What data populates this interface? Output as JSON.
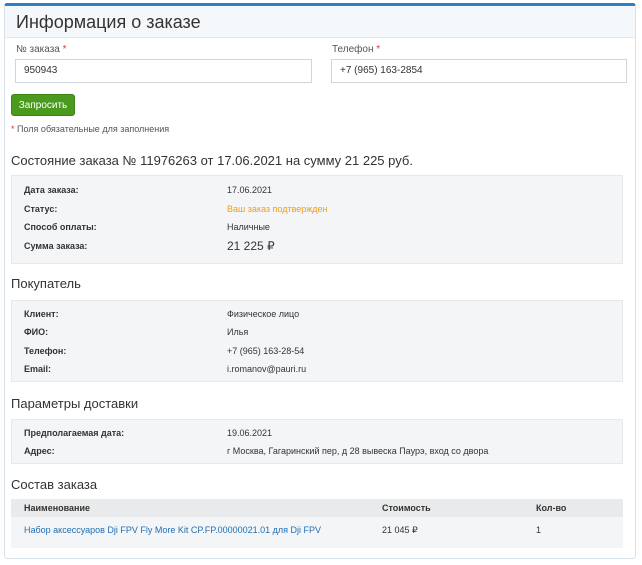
{
  "page": {
    "title": "Информация о заказе"
  },
  "form": {
    "order_label": "№ заказа",
    "order_value": "950943",
    "phone_label": "Телефон",
    "phone_value": "+7 (965) 163-2854",
    "required_mark": "*",
    "submit_label": "Запросить",
    "required_note_mark": "*",
    "required_note_text": "Поля обязательные для заполнения"
  },
  "order_status": {
    "title": "Состояние заказа № 11976263 от 17.06.2021 на сумму 21 225 руб.",
    "rows": [
      {
        "key": "Дата заказа:",
        "value": "17.06.2021"
      },
      {
        "key": "Статус:",
        "value": "Ваш заказ подтвержден"
      },
      {
        "key": "Способ оплаты:",
        "value": "Наличные"
      },
      {
        "key": "Сумма заказа:",
        "value": "21 225 ₽"
      }
    ]
  },
  "buyer": {
    "title": "Покупатель",
    "rows": [
      {
        "key": "Клиент:",
        "value": "Физическое лицо"
      },
      {
        "key": "ФИО:",
        "value": "Илья"
      },
      {
        "key": "Телефон:",
        "value": "+7 (965) 163-28-54"
      },
      {
        "key": "Email:",
        "value": "i.romanov@pauri.ru"
      }
    ]
  },
  "delivery": {
    "title": "Параметры доставки",
    "rows": [
      {
        "key": "Предполагаемая дата:",
        "value": "19.06.2021"
      },
      {
        "key": "Адрес:",
        "value": "г Москва, Гагаринский пер, д 28 вывеска Паурэ, вход со двора"
      }
    ]
  },
  "composition": {
    "title": "Состав заказа",
    "headers": [
      "Наименование",
      "Стоимость",
      "Кол-во"
    ],
    "items": [
      {
        "name": "Набор аксессуаров Dji FPV Fly More Kit CP.FP.00000021.01 для Dji FPV",
        "price": "21 045 ₽",
        "qty": "1"
      }
    ]
  },
  "colors": {
    "accent": "#2f7dc4",
    "button": "#4a9a1e",
    "status": "#f39c12",
    "link": "#1f6fb5",
    "required": "#e3342f"
  }
}
